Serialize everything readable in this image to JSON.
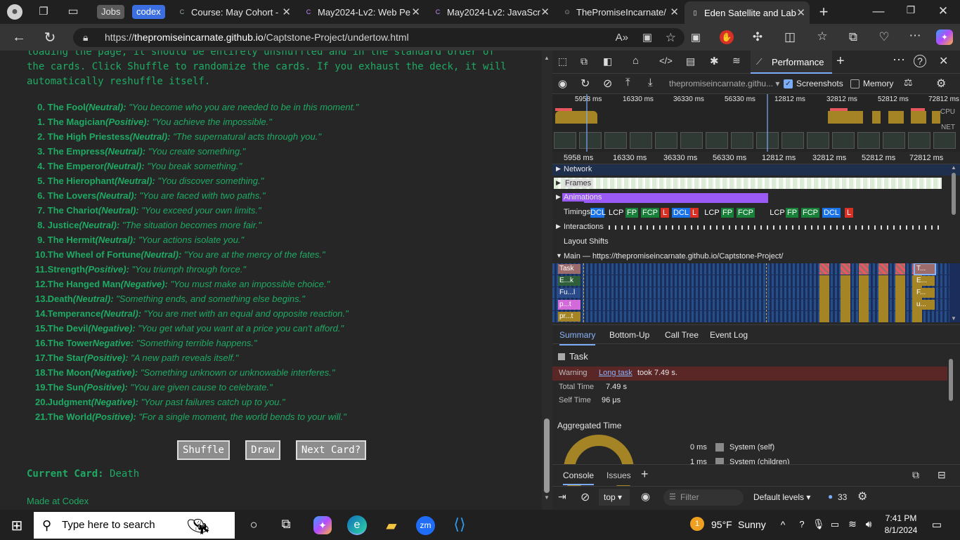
{
  "tabs": {
    "jobs": "Jobs",
    "codex": "codex",
    "items": [
      {
        "title": "Course: May Cohort -",
        "fav": "C"
      },
      {
        "title": "May2024-Lv2: Web Pe",
        "fav": "C"
      },
      {
        "title": "May2024-Lv2: JavaScr",
        "fav": "C"
      },
      {
        "title": "ThePromiseIncarnate/",
        "fav": "⊙"
      },
      {
        "title": "Eden Satellite and Lab",
        "fav": "▯"
      }
    ]
  },
  "address": {
    "prefix": "https://",
    "host": "thepromiseincarnate.github.io",
    "path": "/Captstone-Project/undertow.html"
  },
  "page": {
    "intro_line1": "loading the page, it should be entirely unshuffled and in the standard order of",
    "intro_line2": "the cards. Click Shuffle to randomize the cards. If you exhaust the deck, it will",
    "intro_line3": "automatically reshuffle itself.",
    "cards": [
      {
        "num": "0.",
        "name": "The Fool",
        "tag": "(Neutral):",
        "quote": "\"You become who you are needed to be in this moment.\""
      },
      {
        "num": "1.",
        "name": "The Magician",
        "tag": "(Positive):",
        "quote": "\"You achieve the impossible.\""
      },
      {
        "num": "2.",
        "name": "The High Priestess",
        "tag": "(Neutral):",
        "quote": "\"The supernatural acts through you.\""
      },
      {
        "num": "3.",
        "name": "The Empress",
        "tag": "(Neutral):",
        "quote": "\"You create something.\""
      },
      {
        "num": "4.",
        "name": "The Emperor",
        "tag": "(Neutral):",
        "quote": "\"You break something.\""
      },
      {
        "num": "5.",
        "name": "The Hierophant",
        "tag": "(Neutral):",
        "quote": "\"You discover something.\""
      },
      {
        "num": "6.",
        "name": "The Lovers",
        "tag": "(Neutral):",
        "quote": "\"You are faced with two paths.\""
      },
      {
        "num": "7.",
        "name": "The Chariot",
        "tag": "(Neutral):",
        "quote": "\"You exceed your own limits.\""
      },
      {
        "num": "8.",
        "name": "Justice",
        "tag": "(Neutral):",
        "quote": "\"The situation becomes more fair.\""
      },
      {
        "num": "9.",
        "name": "The Hermit",
        "tag": "(Neutral):",
        "quote": "\"Your actions isolate you.\""
      },
      {
        "num": "10.",
        "name": "The Wheel of Fortune",
        "tag": "(Neutral):",
        "quote": "\"You are at the mercy of the fates.\""
      },
      {
        "num": "11.",
        "name": "Strength",
        "tag": "(Positive):",
        "quote": "\"You triumph through force.\""
      },
      {
        "num": "12.",
        "name": "The Hanged Man",
        "tag": "(Negative):",
        "quote": "\"You must make an impossible choice.\""
      },
      {
        "num": "13.",
        "name": "Death",
        "tag": "(Neutral):",
        "quote": "\"Something ends, and something else begins.\""
      },
      {
        "num": "14.",
        "name": "Temperance",
        "tag": "(Neutral):",
        "quote": "\"You are met with an equal and opposite reaction.\""
      },
      {
        "num": "15.",
        "name": "The Devil",
        "tag": "(Negative):",
        "quote": "\"You get what you want at a price you can't afford.\""
      },
      {
        "num": "16.",
        "name": "The Tower",
        "tag": "Negative:",
        "quote": "\"Something terrible happens.\""
      },
      {
        "num": "17.",
        "name": "The Star",
        "tag": "(Positive):",
        "quote": "\"A new path reveals itself.\""
      },
      {
        "num": "18.",
        "name": "The Moon",
        "tag": "(Negative):",
        "quote": "\"Something unknown or unknowable interferes.\""
      },
      {
        "num": "19.",
        "name": "The Sun",
        "tag": "(Positive):",
        "quote": "\"You are given cause to celebrate.\""
      },
      {
        "num": "20.",
        "name": "Judgment",
        "tag": "(Negative):",
        "quote": "\"Your past failures catch up to you.\""
      },
      {
        "num": "21.",
        "name": "The World",
        "tag": "(Positive):",
        "quote": "\"For a single moment, the world bends to your will.\""
      }
    ],
    "shuffle": "Shuffle",
    "draw": "Draw",
    "next": "Next Card?",
    "current_label": "Current Card:",
    "current_value": "Death",
    "made": "Made at Codex"
  },
  "devtools": {
    "perf_tab": "Performance",
    "origin": "thepromiseincarnate.githu...",
    "screenshots": "Screenshots",
    "memory": "Memory",
    "overview_ticks": [
      "5958 ms",
      "16330 ms",
      "36330 ms",
      "56330 ms",
      "12812 ms",
      "32812 ms",
      "52812 ms",
      "72812 ms"
    ],
    "cpu": "CPU",
    "net": "NET",
    "ruler_ticks": [
      "5958 ms",
      "16330 ms",
      "36330 ms",
      "56330 ms",
      "12812 ms",
      "32812 ms",
      "52812 ms",
      "72812 ms"
    ],
    "tracks": {
      "network": "Network",
      "frames": "Frames",
      "animations": "Animations",
      "timings": "Timings",
      "interactions": "Interactions",
      "layout_shifts": "Layout Shifts"
    },
    "timing_pills": [
      {
        "t": "DCL",
        "c": "#1a73e8"
      },
      {
        "t": "LCP",
        "c": "#282828"
      },
      {
        "t": "FP",
        "c": "#188038"
      },
      {
        "t": "FCP",
        "c": "#188038"
      },
      {
        "t": "L",
        "c": "#d93025"
      },
      {
        "t": "DCL",
        "c": "#1a73e8"
      },
      {
        "t": "L",
        "c": "#d93025"
      },
      {
        "t": "LCP",
        "c": "#282828"
      },
      {
        "t": "FP",
        "c": "#188038"
      },
      {
        "t": "FCP",
        "c": "#188038"
      },
      {
        "t": "LCP",
        "c": "#282828"
      },
      {
        "t": "FP",
        "c": "#188038"
      },
      {
        "t": "FCP",
        "c": "#188038"
      },
      {
        "t": "DCL",
        "c": "#1a73e8"
      },
      {
        "t": "L",
        "c": "#d93025"
      }
    ],
    "main_label": "Main — https://thepromiseincarnate.github.io/Captstone-Project/",
    "flame_labels": [
      "Task",
      "E...k",
      "Fu...l",
      "p...t",
      "pr...t"
    ],
    "flame_right": [
      "T...",
      "E...",
      "F...",
      "u..."
    ],
    "bottom_tabs": [
      "Summary",
      "Bottom-Up",
      "Call Tree",
      "Event Log"
    ],
    "summary": {
      "title": "Task",
      "warning_label": "Warning",
      "warning_link": "Long task",
      "warning_text": "took 7.49 s.",
      "total_label": "Total Time",
      "total_value": "7.49 s",
      "self_label": "Self Time",
      "self_value": "96 μs",
      "agg_title": "Aggregated Time",
      "agg_row1_value": "0 ms",
      "agg_row1_label": "System (self)",
      "agg_row2_value": "1 ms",
      "agg_row2_label": "System (children)"
    },
    "drawer_tabs": [
      "Console",
      "Issues"
    ],
    "context": "top",
    "filter_placeholder": "Filter",
    "levels": "Default levels",
    "issues_count": "33"
  },
  "taskbar": {
    "search_placeholder": "Type here to search",
    "temp": "95°F",
    "weather": "Sunny",
    "time": "7:41 PM",
    "date": "8/1/2024"
  },
  "colors": {
    "page_green": "#1faa64",
    "accent_blue": "#1a73e8",
    "danger": "#d93025"
  }
}
